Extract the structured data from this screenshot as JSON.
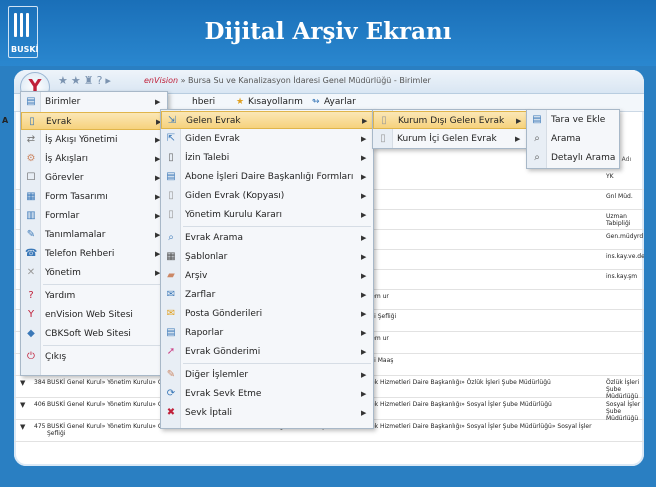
{
  "banner": {
    "title": "Dijital Arşiv Ekranı",
    "logo_text": "BUSKİ"
  },
  "app": {
    "brand": "enVision",
    "title_rest": " » Bursa Su ve Kanalizasyon İdaresi Genel Müdürlüğü - Birimler",
    "quick_icons": "★★♜?▸"
  },
  "toolbar": {
    "left_partial": "hberi",
    "shortcuts": "Kısayollarım",
    "settings": "Ayarlar",
    "edge_letter": "A"
  },
  "menu_main": [
    {
      "label": "Birimler",
      "icon": "building-icon",
      "glyph": "▤",
      "arrow": true
    },
    {
      "label": "Evrak",
      "icon": "document-icon",
      "glyph": "▯",
      "arrow": true,
      "active": true
    },
    {
      "label": "İş Akışı Yönetimi",
      "icon": "workflow-icon",
      "glyph": "⇄",
      "arrow": true
    },
    {
      "label": "İş Akışları",
      "icon": "flow-icon",
      "glyph": "⚙",
      "arrow": true
    },
    {
      "label": "Görevler",
      "icon": "task-icon",
      "glyph": "☐",
      "arrow": true
    },
    {
      "label": "Form Tasarımı",
      "icon": "form-design-icon",
      "glyph": "▦",
      "arrow": true
    },
    {
      "label": "Formlar",
      "icon": "form-icon",
      "glyph": "▥",
      "arrow": true
    },
    {
      "label": "Tanımlamalar",
      "icon": "definitions-icon",
      "glyph": "✎",
      "arrow": true
    },
    {
      "label": "Telefon Rehberi",
      "icon": "phonebook-icon",
      "glyph": "☎",
      "arrow": true
    },
    {
      "label": "Yönetim",
      "icon": "admin-icon",
      "glyph": "✕",
      "arrow": true
    },
    {
      "label": "Yardım",
      "icon": "help-icon",
      "glyph": "?",
      "arrow": false
    },
    {
      "label": "enVision Web Sitesi",
      "icon": "envision-icon",
      "glyph": "Y",
      "arrow": false
    },
    {
      "label": "CBKSoft Web Sitesi",
      "icon": "cbksoft-icon",
      "glyph": "◆",
      "arrow": false
    },
    {
      "label": "Çıkış",
      "icon": "exit-icon",
      "glyph": "⏻",
      "arrow": false
    }
  ],
  "menu_evrak": [
    {
      "label": "Gelen Evrak",
      "icon": "incoming-document-icon",
      "glyph": "⇲",
      "active": true
    },
    {
      "label": "Giden Evrak",
      "icon": "outgoing-document-icon",
      "glyph": "⇱"
    },
    {
      "label": "İzin Talebi",
      "icon": "leave-request-icon",
      "glyph": "▯"
    },
    {
      "label": "Abone İşleri Daire Başkanlığı Formları",
      "icon": "subscriber-forms-icon",
      "glyph": "▤"
    },
    {
      "label": "Giden Evrak (Kopyası)",
      "icon": "outgoing-copy-icon",
      "glyph": "▯"
    },
    {
      "label": "Yönetim Kurulu Kararı",
      "icon": "board-decision-icon",
      "glyph": "▯"
    },
    {
      "label": "Evrak Arama",
      "icon": "document-search-icon",
      "glyph": "⌕"
    },
    {
      "label": "Şablonlar",
      "icon": "templates-icon",
      "glyph": "▦"
    },
    {
      "label": "Arşiv",
      "icon": "archive-icon",
      "glyph": "▰"
    },
    {
      "label": "Zarflar",
      "icon": "envelopes-icon",
      "glyph": "✉"
    },
    {
      "label": "Posta Gönderileri",
      "icon": "mail-icon",
      "glyph": "✉"
    },
    {
      "label": "Raporlar",
      "icon": "reports-icon",
      "glyph": "▤"
    },
    {
      "label": "Evrak Gönderimi",
      "icon": "document-send-icon",
      "glyph": "➚"
    },
    {
      "label": "Diğer İşlemler",
      "icon": "other-operations-icon",
      "glyph": "✎"
    },
    {
      "label": "Evrak Sevk Etme",
      "icon": "dispatch-icon",
      "glyph": "⟳"
    },
    {
      "label": "Sevk İptali",
      "icon": "dispatch-cancel-icon",
      "glyph": "✖"
    }
  ],
  "menu_gelen": [
    {
      "label": "Kurum Dışı Gelen Evrak",
      "icon": "external-document-icon",
      "glyph": "▯",
      "active": true
    },
    {
      "label": "Kurum İçi Gelen Evrak",
      "icon": "internal-document-icon",
      "glyph": "▯"
    }
  ],
  "menu_kurum_disi": [
    {
      "label": "Tara ve Ekle",
      "icon": "scanner-icon",
      "glyph": "▤"
    },
    {
      "label": "Arama",
      "icon": "search-icon",
      "glyph": "⌕"
    },
    {
      "label": "Detaylı Arama",
      "icon": "detailed-search-icon",
      "glyph": "⌕"
    }
  ],
  "grid": {
    "header_right": "Birim Adı",
    "rows": [
      {
        "id": "",
        "c1": "",
        "c2": "",
        "c3": "YK"
      },
      {
        "id": "",
        "c1": "",
        "c2": "",
        "c3": "Gnl Müd."
      },
      {
        "id": "",
        "c1": "",
        "c2": "",
        "c3": "Uzman Tabipliği"
      },
      {
        "id": "",
        "c1": "",
        "c2": "",
        "c3": "Gen.müdyrd1"
      },
      {
        "id": "",
        "c1": "",
        "c2": "ek Hizmetleri Daire Başkanlığı",
        "c3": "ins.kay.ve.des.hiz"
      },
      {
        "id": "",
        "c1": "",
        "c2": "ek Hizmetleri Daire Başkanlığı» İnsan Kaynakları Şube Müdürlüğü",
        "c3": "ins.kay.şm"
      },
      {
        "id": "",
        "c1": "",
        "c2": "ek Hizmetleri Daire Başkanlığı» İnsan Kaynakları Şube Müdürlüğü» Mem ur",
        "c3": ""
      },
      {
        "id": "461",
        "c1": "BUSKİ Genel Kurul» Yönetim Kurulu»",
        "c2": "ek Hizmetleri Daire Başkanlığı» İnsan Kaynakları Şube Müdürlüğü» İşçi Şefliği",
        "c3": ""
      },
      {
        "id": "462",
        "c1": "BUSKİ Genel Kurul» Yönetim Kurulu» Maaş Şefliği",
        "c2": "ek Hizmetleri Daire Başkanlığı» İnsan Kaynakları Şube Müdürlüğü» Mem ur",
        "c3": ""
      },
      {
        "id": "463",
        "c1": "BUSKİ Genel Kurul» Yönetim Kurulu» Şefliği",
        "c2": "ek Hizmetleri Daire Başkanlığı» İnsan Kaynakları Şube Müdürlüğü» İşçi Maaş",
        "c3": ""
      },
      {
        "id": "384",
        "c1": "BUSKİ Genel Kurul» Yönetim Kurulu» Genel Müdürlük» Genel Müdür Yardımcılığı 1» İnsan Kaynakları ve Destek Hizmetleri Daire Başkanlığı» Özlük İşleri Şube Müdürlüğü",
        "c2": "",
        "c3": "Özlük İşleri Şube Müdürlüğü"
      },
      {
        "id": "406",
        "c1": "BUSKİ Genel Kurul» Yönetim Kurulu» Genel Müdürlük» Genel Müdür Yardımcılığı 1» İnsan Kaynakları ve Destek Hizmetleri Daire Başkanlığı» Sosyal İşler Şube Müdürlüğü",
        "c2": "",
        "c3": "Sosyal İşler Şube Müdürlüğü"
      },
      {
        "id": "475",
        "c1": "BUSKİ Genel Kurul» Yönetim Kurulu» Genel Müdürlük» Genel Müdür Yardımcılığı 1» İnsan Kaynakları ve Destek Hizmetleri Daire Başkanlığı» Sosyal İşler Şube Müdürlüğü» Sosyal İşler Şefliği",
        "c2": "",
        "c3": ""
      }
    ]
  },
  "colors": {
    "frame": "#2a7fc2",
    "highlight": "#f6d27d",
    "brand_red": "#c0203a"
  }
}
